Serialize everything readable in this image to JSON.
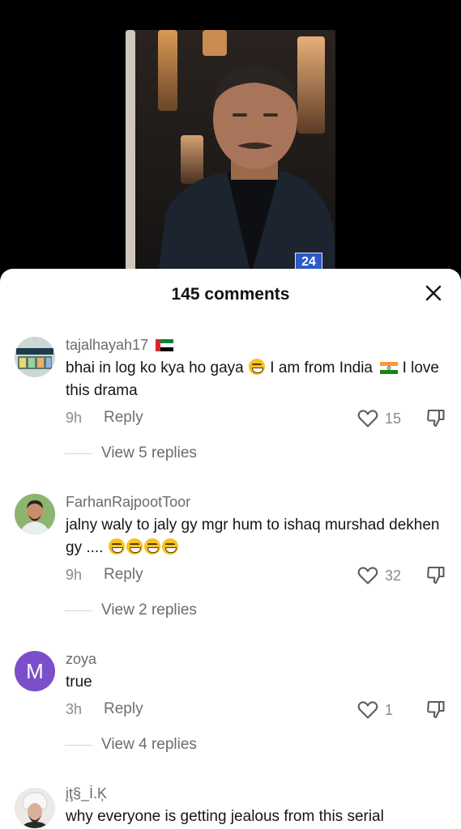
{
  "header": {
    "title": "145 comments"
  },
  "video": {
    "channel_badge": "24"
  },
  "comments": [
    {
      "username": "tajalhayah17",
      "username_flag": "uae-flag-icon",
      "text_part1": "bhai in log ko kya ho gaya",
      "text_part2": "I am from India",
      "text_part3": "I love this drama",
      "time": "9h",
      "reply_label": "Reply",
      "likes": "15",
      "view_replies": "View 5 replies"
    },
    {
      "username": "FarhanRajpootToor",
      "text_part1": "jalny waly to jaly gy mgr hum to ishaq murshad dekhen gy ....",
      "time": "9h",
      "reply_label": "Reply",
      "likes": "32",
      "view_replies": "View 2 replies"
    },
    {
      "username": "zoya",
      "avatar_letter": "M",
      "text_part1": "true",
      "time": "3h",
      "reply_label": "Reply",
      "likes": "1",
      "view_replies": "View 4 replies"
    },
    {
      "username": "įţ§_İ.Ķ",
      "text_part1": "why everyone is getting jealous from this serial"
    }
  ],
  "colors": {
    "avatar_purple": "#7b4fc9",
    "text_primary": "#161616",
    "text_secondary": "#6b6b6b"
  }
}
